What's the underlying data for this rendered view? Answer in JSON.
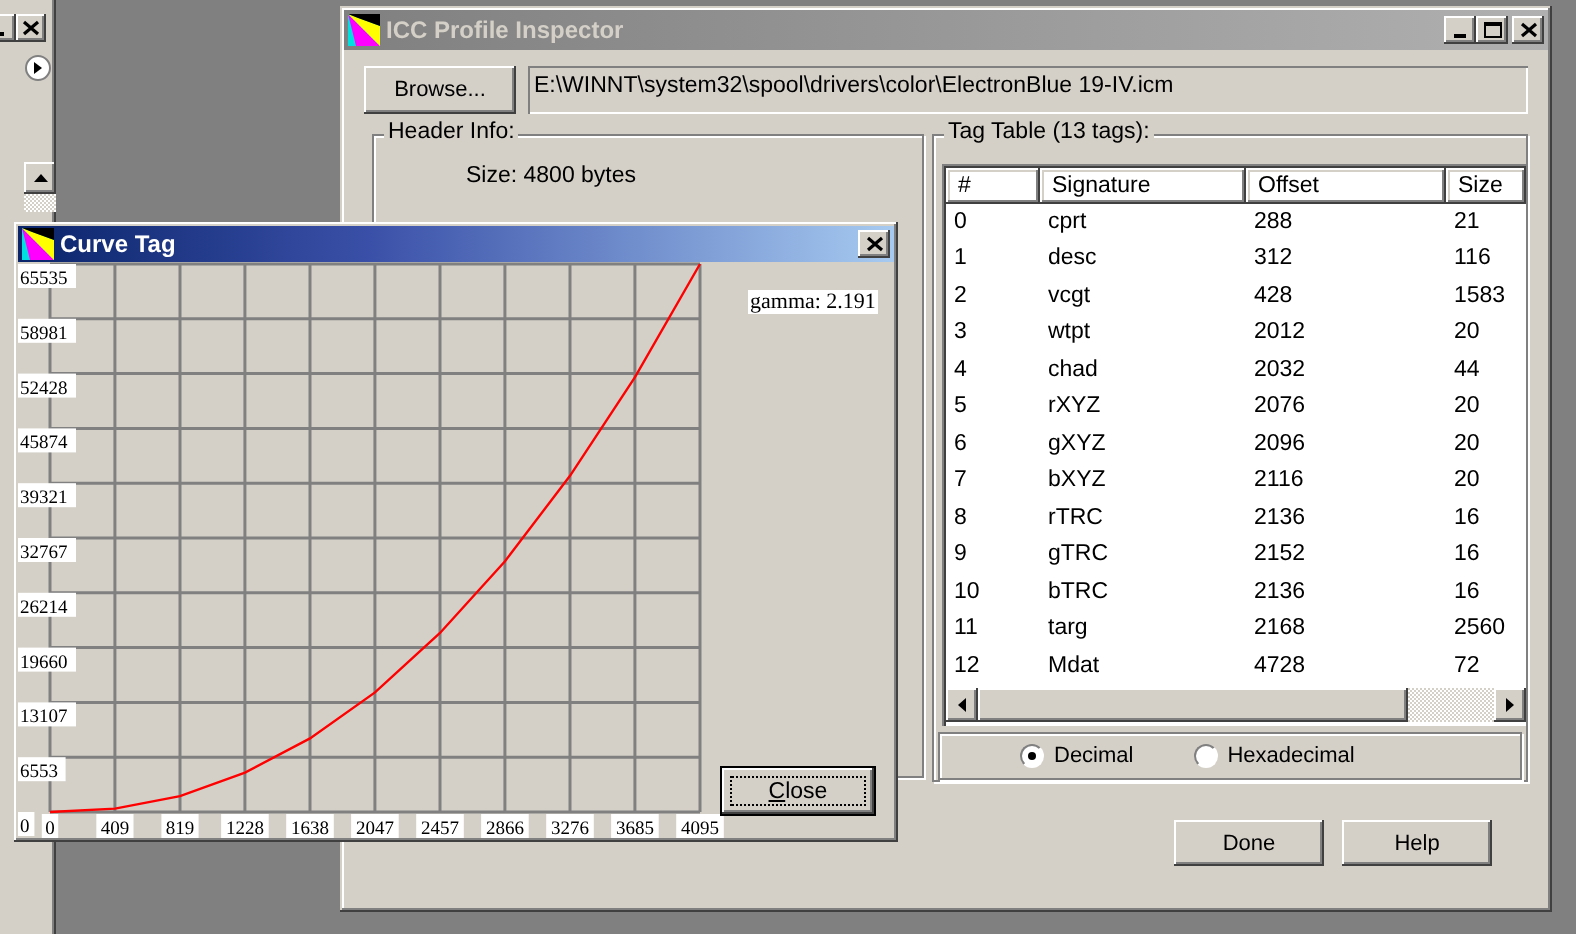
{
  "main_window": {
    "title": "ICC Profile Inspector",
    "browse_button": "Browse...",
    "file_path": "E:\\WINNT\\system32\\spool\\drivers\\color\\ElectronBlue 19-IV.icm",
    "header_info": {
      "title": "Header Info:",
      "size": "Size: 4800 bytes"
    },
    "tag_table": {
      "title": "Tag Table (13 tags):",
      "columns": [
        "#",
        "Signature",
        "Offset",
        "Size"
      ],
      "rows": [
        [
          "0",
          "cprt",
          "288",
          "21"
        ],
        [
          "1",
          "desc",
          "312",
          "116"
        ],
        [
          "2",
          "vcgt",
          "428",
          "1583"
        ],
        [
          "3",
          "wtpt",
          "2012",
          "20"
        ],
        [
          "4",
          "chad",
          "2032",
          "44"
        ],
        [
          "5",
          "rXYZ",
          "2076",
          "20"
        ],
        [
          "6",
          "gXYZ",
          "2096",
          "20"
        ],
        [
          "7",
          "bXYZ",
          "2116",
          "20"
        ],
        [
          "8",
          "rTRC",
          "2136",
          "16"
        ],
        [
          "9",
          "gTRC",
          "2152",
          "16"
        ],
        [
          "10",
          "bTRC",
          "2136",
          "16"
        ],
        [
          "11",
          "targ",
          "2168",
          "2560"
        ],
        [
          "12",
          "Mdat",
          "4728",
          "72"
        ]
      ]
    },
    "format_options": [
      {
        "label": "Decimal",
        "selected": true
      },
      {
        "label": "Hexadecimal",
        "selected": false
      }
    ],
    "buttons": [
      "Done",
      "Help"
    ]
  },
  "curve_window": {
    "title": "Curve Tag",
    "gamma_label": "gamma: 2.191",
    "close_button": "Close",
    "chart_data": {
      "type": "line",
      "x": [
        0,
        409,
        819,
        1228,
        1638,
        2047,
        2457,
        2866,
        3276,
        3685,
        4095
      ],
      "grid": true,
      "series": [
        {
          "color": "#ff0000",
          "values": [
            0,
            400,
            1900,
            4700,
            8800,
            14300,
            21400,
            30000,
            40200,
            52000,
            65535
          ]
        }
      ],
      "xlim": [
        0,
        4095
      ],
      "ylim": [
        0,
        65535
      ],
      "xticks": [
        0,
        409,
        819,
        1228,
        1638,
        2047,
        2457,
        2866,
        3276,
        3685,
        4095
      ],
      "yticks": [
        0,
        6553,
        13107,
        19660,
        26214,
        32767,
        39321,
        45874,
        52428,
        58981,
        65535
      ]
    }
  }
}
